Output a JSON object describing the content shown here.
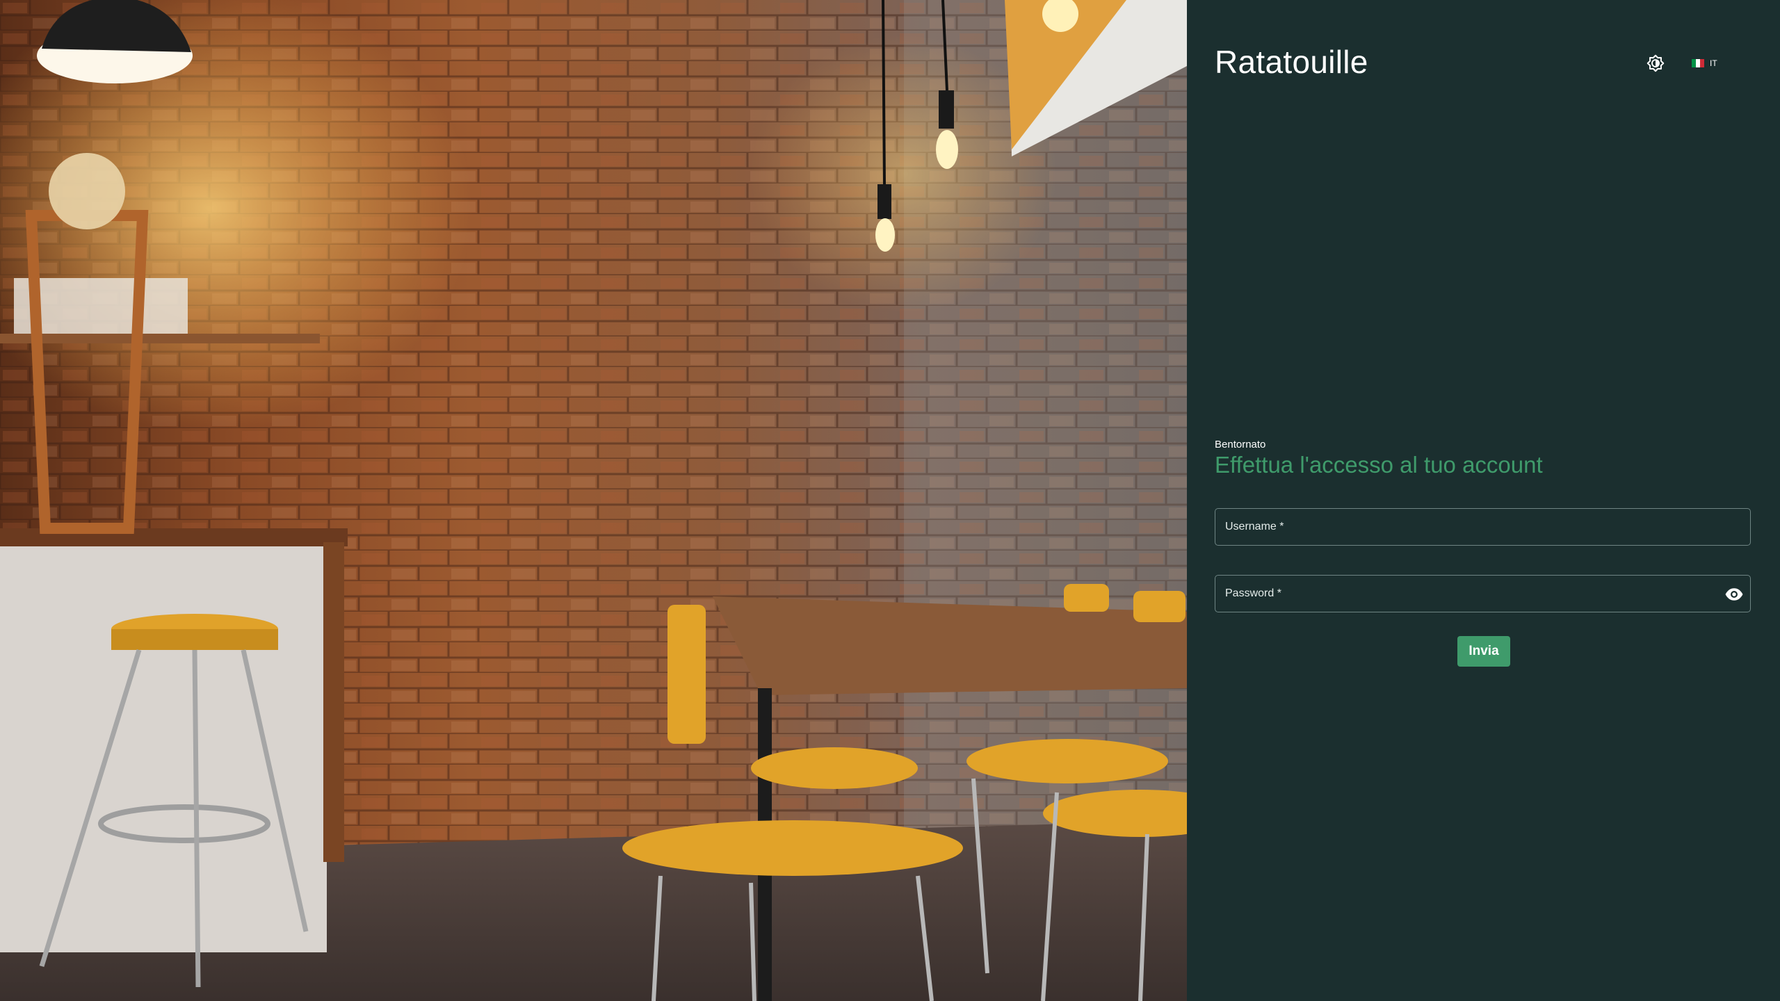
{
  "app": {
    "title": "Ratatouille"
  },
  "header": {
    "theme_icon": "brightness-icon",
    "language": {
      "code": "IT",
      "flag": [
        "#009246",
        "#ffffff",
        "#ce2b37"
      ]
    }
  },
  "login": {
    "welcome": "Bentornato",
    "headline": "Effettua l'accesso al tuo account",
    "username": {
      "label": "Username *",
      "value": ""
    },
    "password": {
      "label": "Password *",
      "value": "",
      "toggle_icon": "eye-icon"
    },
    "submit_label": "Invia"
  },
  "colors": {
    "panel_bg": "#1b2f2f",
    "accent": "#3f9b6b",
    "text": "#ffffff"
  }
}
